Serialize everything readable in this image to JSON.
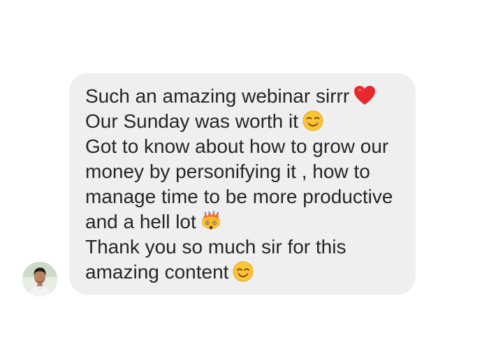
{
  "message": {
    "lines": [
      {
        "text": "Such an amazing webinar sirrr",
        "emoji": "red-heart-icon"
      },
      {
        "text": "Our Sunday was worth it",
        "emoji": "smiling-face-icon"
      },
      {
        "text": "Got to know about how to grow our"
      },
      {
        "text": "money by personifying it , how to"
      },
      {
        "text": "manage time to be more productive"
      },
      {
        "text": "and a hell lot",
        "emoji": "exploding-head-icon"
      },
      {
        "text": "Thank you so much sir for this"
      },
      {
        "text": "amazing content",
        "emoji": "smiling-face-with-smiling-eyes-icon"
      }
    ]
  },
  "colors": {
    "bubble_background": "#efefef",
    "text": "#262626",
    "page_background": "#ffffff"
  }
}
